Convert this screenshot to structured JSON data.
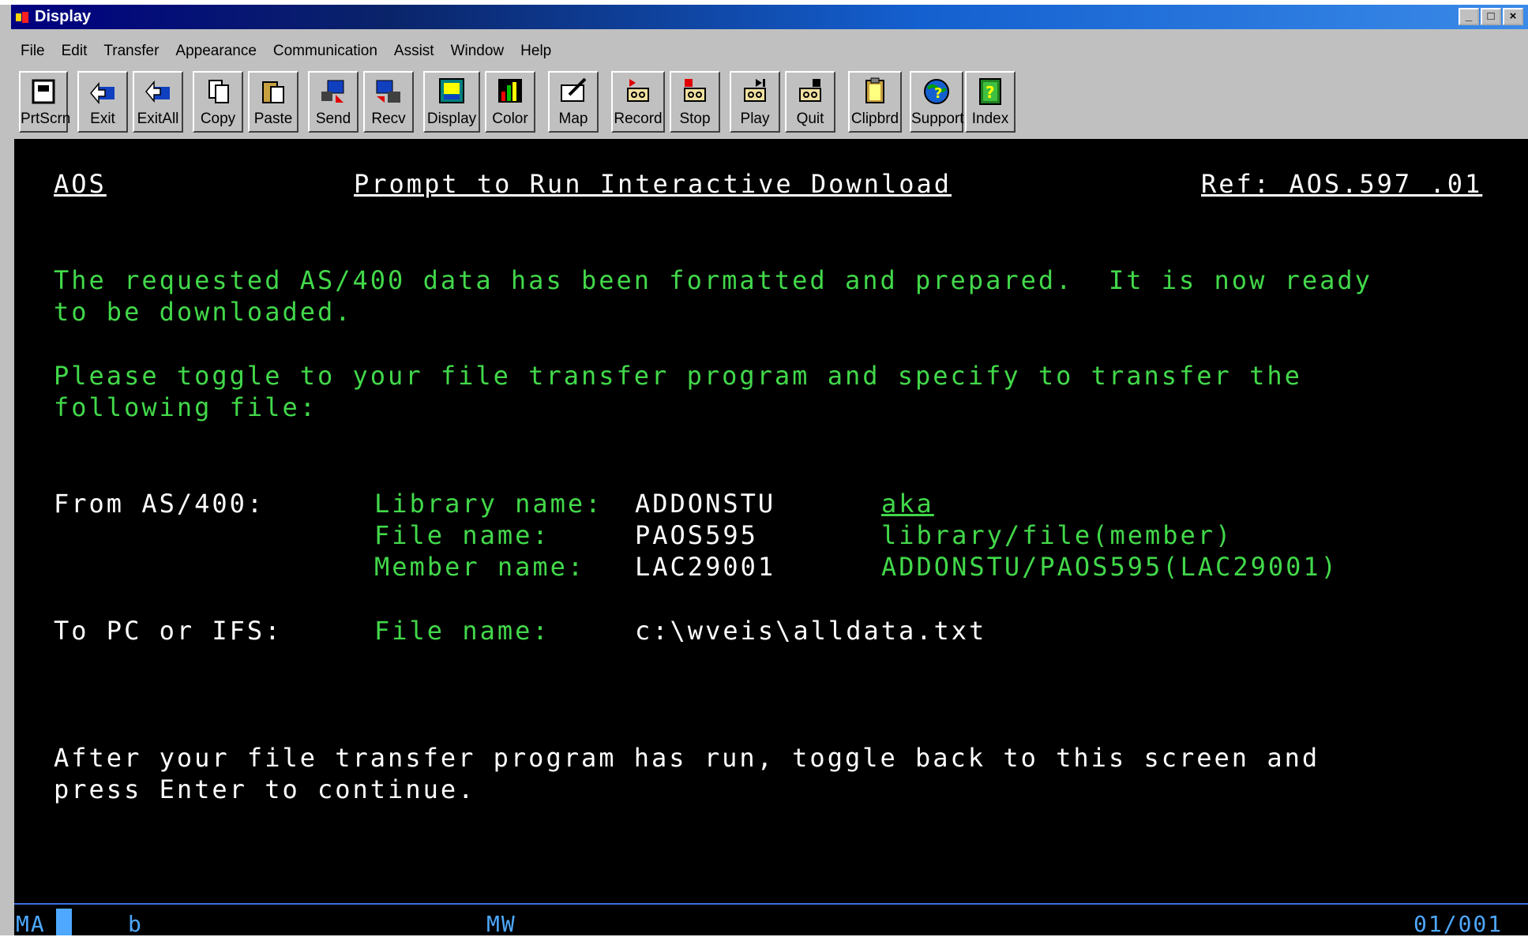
{
  "window": {
    "title": "Display",
    "controls": [
      "_",
      "□",
      "×"
    ]
  },
  "menu": [
    "File",
    "Edit",
    "Transfer",
    "Appearance",
    "Communication",
    "Assist",
    "Window",
    "Help"
  ],
  "toolbar": [
    {
      "label": "PrtScrn",
      "icon": "printer-icon"
    },
    {
      "label": "Exit",
      "icon": "exit-icon"
    },
    {
      "label": "ExitAll",
      "icon": "exit-all-icon"
    },
    {
      "label": "Copy",
      "icon": "copy-icon"
    },
    {
      "label": "Paste",
      "icon": "paste-icon"
    },
    {
      "label": "Send",
      "icon": "send-icon"
    },
    {
      "label": "Recv",
      "icon": "receive-icon"
    },
    {
      "label": "Display",
      "icon": "display-icon"
    },
    {
      "label": "Color",
      "icon": "color-icon"
    },
    {
      "label": "Map",
      "icon": "map-icon"
    },
    {
      "label": "Record",
      "icon": "record-icon"
    },
    {
      "label": "Stop",
      "icon": "stop-icon"
    },
    {
      "label": "Play",
      "icon": "play-icon"
    },
    {
      "label": "Quit",
      "icon": "quit-icon"
    },
    {
      "label": "Clipbrd",
      "icon": "clipboard-icon"
    },
    {
      "label": "Support",
      "icon": "support-icon"
    },
    {
      "label": "Index",
      "icon": "index-icon"
    }
  ],
  "screen": {
    "header": {
      "left": "AOS",
      "center": "Prompt to Run Interactive Download",
      "right": "Ref: AOS.597 .01"
    },
    "para1": [
      "The requested AS/400 data has been formatted and prepared.  It is now ready",
      "to be downloaded."
    ],
    "para2": [
      "Please toggle to your file transfer program and specify to transfer the",
      "following file:"
    ],
    "from": {
      "label": "From AS/400:",
      "library_label": "Library name:",
      "library_value": "ADDONSTU",
      "aka": "aka",
      "file_label": "File name:",
      "file_value": "PAOS595",
      "format_hint": "library/file(member)",
      "member_label": "Member name:",
      "member_value": "LAC29001",
      "full_path": "ADDONSTU/PAOS595(LAC29001)"
    },
    "to": {
      "label": "To PC or IFS:",
      "file_label": "File name:",
      "file_value": "c:\\wveis\\alldata.txt"
    },
    "para3": [
      "After your file transfer program has run, toggle back to this screen and",
      "press Enter to continue."
    ]
  },
  "status": {
    "left": "MA",
    "indicator": "b",
    "mode": "MW",
    "position": "01/001"
  }
}
